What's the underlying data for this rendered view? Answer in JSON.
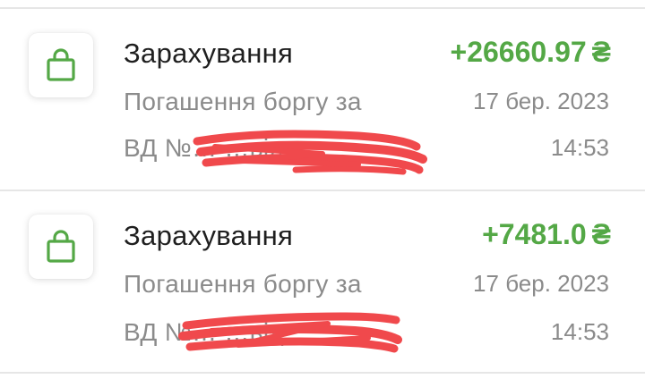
{
  "colors": {
    "accent_green": "#54a846",
    "text_primary": "#1f1f1f",
    "text_secondary": "#8b8b8b",
    "redaction": "#f0494c"
  },
  "transactions": [
    {
      "icon": "shopping-bag-icon",
      "title": "Зарахування",
      "amount": "+26660.97",
      "currency": "₴",
      "description_line1": "Погашення боргу за",
      "description_line2": "ВД №… …від …",
      "date": "17 бер. 2023",
      "time": "14:53"
    },
    {
      "icon": "shopping-bag-icon",
      "title": "Зарахування",
      "amount": "+7481.0",
      "currency": "₴",
      "description_line1": "Погашення боргу за",
      "description_line2": "ВД №… …від …",
      "date": "17 бер. 2023",
      "time": "14:53"
    }
  ]
}
